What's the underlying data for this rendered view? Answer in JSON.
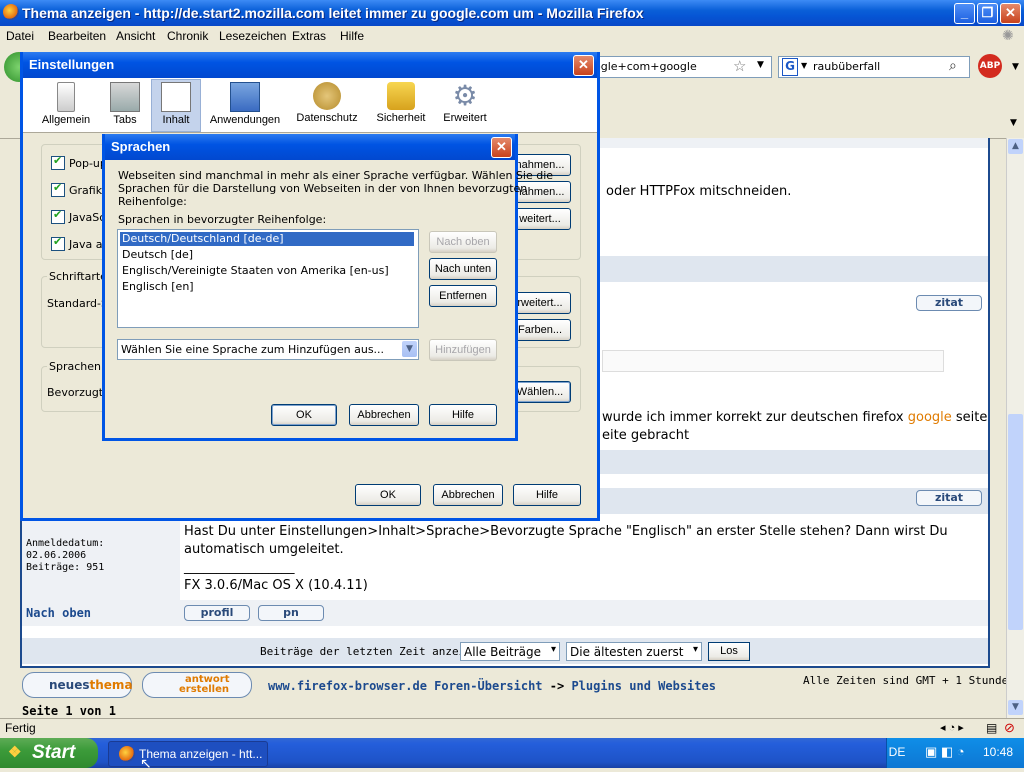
{
  "window": {
    "title": "Thema anzeigen - http://de.start2.mozilla.com leitet immer zu google.com um - Mozilla Firefox"
  },
  "menu": [
    "Datei",
    "Bearbeiten",
    "Ansicht",
    "Chronik",
    "Lesezeichen",
    "Extras",
    "Hilfe"
  ],
  "toolbar": {
    "url_fragment": "ogle+com+google",
    "search_value": "raubüberfall",
    "search_engine_letter": "G",
    "abp_label": "ABP"
  },
  "forum": {
    "visible_text_1": "oder HTTPFox mitschneiden.",
    "zitat_label": "zitat",
    "post_line1_before": "wurde ich immer korrekt zur deutschen firefox ",
    "post_line1_highlight": "google",
    "post_line1_after": " seite",
    "post_line2": "eite gebracht",
    "meta_anmeldedatum_label": "Anmeldedatum:",
    "meta_anmeldedatum_value": "02.06.2006",
    "meta_beitraege": "Beiträge: 951",
    "reply_line1": "Hast Du unter Einstellungen>Inhalt>Sprache>Bevorzugte Sprache \"Englisch\" an erster Stelle stehen? Dann wirst Du",
    "reply_line2": "automatisch umgeleitet.",
    "signature_rule": "_________________",
    "signature": "FX 3.0.6/Mac OS X (10.4.11)",
    "nach_oben": "Nach oben",
    "profil_label": "profil",
    "pn_label": "pn",
    "filter_label": "Beiträge der letzten Zeit anzeigen:",
    "filter_value": "Alle Beiträge",
    "order_value": "Die ältesten zuerst",
    "los_label": "Los",
    "new_topic_label_1": "neues",
    "new_topic_label_2": "thema",
    "answer_label_1": "antwort",
    "answer_label_2": "erstellen",
    "breadcrumb_home": "www.firefox-browser.de Foren-Übersicht",
    "breadcrumb_sep": " -> ",
    "breadcrumb_section": "Plugins und Websites",
    "timezone": "Alle Zeiten sind GMT + 1 Stunde",
    "page_info": "Seite 1 von 1"
  },
  "statusbar": {
    "text": "Fertig"
  },
  "taskbar": {
    "start": "Start",
    "task_title": "Thema anzeigen - htt...",
    "lang": "DE",
    "clock": "10:48"
  },
  "settings": {
    "title": "Einstellungen",
    "panes": [
      {
        "label": "Allgemein",
        "icon": "switch-icon"
      },
      {
        "label": "Tabs",
        "icon": "tabs-icon"
      },
      {
        "label": "Inhalt",
        "icon": "content-icon"
      },
      {
        "label": "Anwendungen",
        "icon": "applications-icon"
      },
      {
        "label": "Datenschutz",
        "icon": "privacy-mask-icon"
      },
      {
        "label": "Sicherheit",
        "icon": "padlock-icon"
      },
      {
        "label": "Erweitert",
        "icon": "gear-icon"
      }
    ],
    "checkbox_popup": "Pop-up",
    "checkbox_grafik": "Grafike",
    "checkbox_js": "JavaSc",
    "checkbox_java": "Java al",
    "btn_ausnahmen1": "nahmen...",
    "btn_ausnahmen2": "nahmen...",
    "btn_erweitert1": "weitert...",
    "group_fonts": "Schriftarten",
    "standard_label": "Standard-Sc",
    "btn_erweitert2": "rweitert...",
    "btn_farben": "Farben...",
    "group_lang": "Sprachen",
    "bevorzugte_label": "Bevorzugte",
    "btn_waehlen": "Wählen...",
    "ok": "OK",
    "cancel": "Abbrechen",
    "help": "Hilfe"
  },
  "lang_dialog": {
    "title": "Sprachen",
    "description_1": "Webseiten sind manchmal in mehr als einer Sprache verfügbar. Wählen Sie die",
    "description_2": "Sprachen für die Darstellung von Webseiten in der von Ihnen bevorzugten",
    "description_3": "Reihenfolge:",
    "list_label": "Sprachen in bevorzugter Reihenfolge:",
    "languages": [
      "Deutsch/Deutschland  [de-de]",
      "Deutsch  [de]",
      "Englisch/Vereinigte Staaten von Amerika  [en-us]",
      "Englisch  [en]"
    ],
    "selected_index": 0,
    "btn_up": "Nach oben",
    "btn_down": "Nach unten",
    "btn_remove": "Entfernen",
    "add_placeholder": "Wählen Sie eine Sprache zum Hinzufügen aus...",
    "btn_add": "Hinzufügen",
    "ok": "OK",
    "cancel": "Abbrechen",
    "help": "Hilfe"
  }
}
